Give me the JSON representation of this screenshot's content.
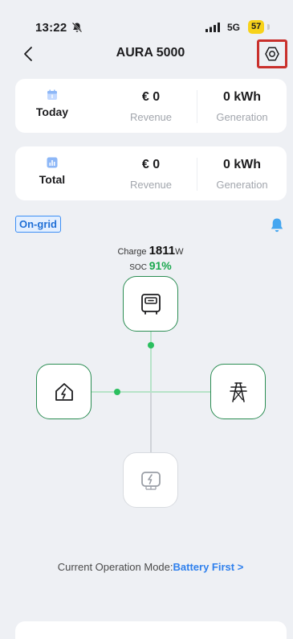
{
  "status_bar": {
    "time": "13:22",
    "network": "5G",
    "battery": "57",
    "icons": [
      "bell-slash-icon",
      "cellular-signal-icon"
    ]
  },
  "header": {
    "title": "AURA 5000",
    "back_icon": "chevron-left-icon",
    "settings_icon": "hexagon-settings-icon"
  },
  "cards": [
    {
      "label": "Today",
      "icon": "calendar-icon",
      "revenue_value": "€ 0",
      "revenue_label": "Revenue",
      "generation_value": "0 kWh",
      "generation_label": "Generation"
    },
    {
      "label": "Total",
      "icon": "bar-chart-icon",
      "revenue_value": "€ 0",
      "revenue_label": "Revenue",
      "generation_value": "0 kWh",
      "generation_label": "Generation"
    }
  ],
  "grid_status": "On-grid",
  "alert_icon": "bell-icon",
  "energy": {
    "charge_label": "Charge",
    "charge_value": "1811",
    "charge_unit": "W",
    "soc_label": "SOC",
    "soc_value": "91%"
  },
  "flow_nodes": {
    "battery": "battery-storage-icon",
    "home": "home-power-icon",
    "grid": "power-tower-icon",
    "charger": "ev-charger-icon"
  },
  "mode": {
    "label": "Current Operation Mode:",
    "value": "Battery First >"
  },
  "colors": {
    "accent_blue": "#2f80ed",
    "node_green": "#2b8d53",
    "soc_green": "#1aa84f",
    "highlight_red": "#c9302c",
    "battery_yellow": "#f7d21a"
  }
}
